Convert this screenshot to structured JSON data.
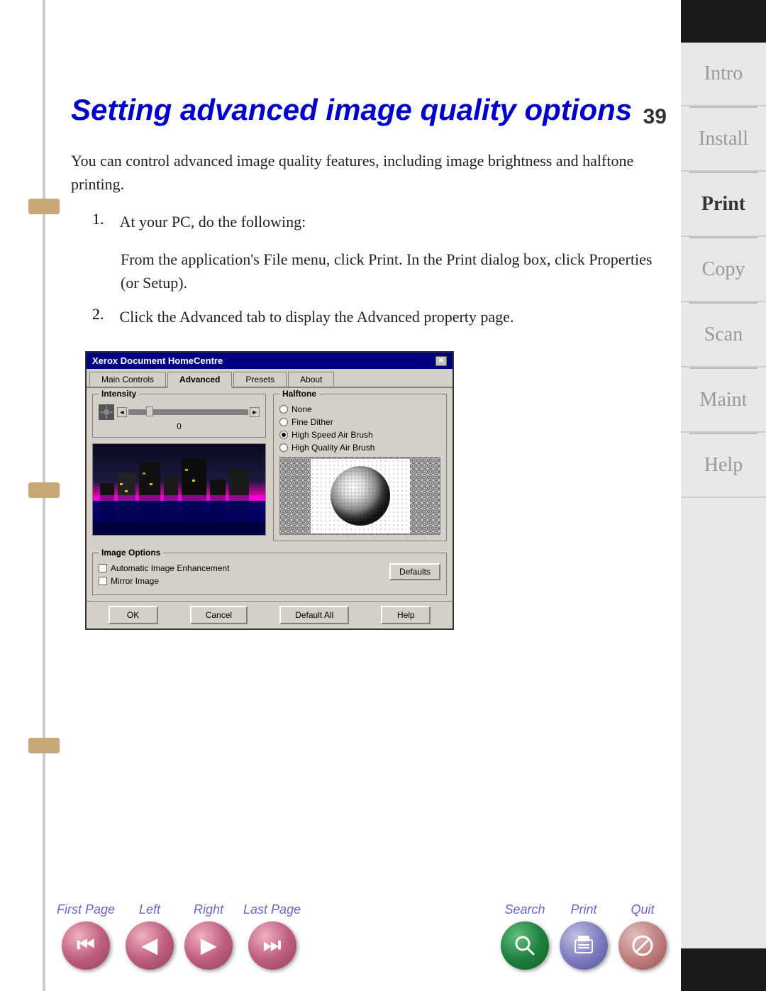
{
  "page": {
    "number": "39",
    "title": "Setting advanced image quality options",
    "body_text_1": "You can control advanced image quality features, including image brightness and halftone printing.",
    "list_item_1_number": "1.",
    "list_item_1_text": "At your PC, do the following:",
    "list_item_1_sub": "From the application's File menu, click Print. In the Print dialog box, click Properties (or Setup).",
    "list_item_2_number": "2.",
    "list_item_2_text": "Click the Advanced tab to display the Advanced property page."
  },
  "dialog": {
    "title": "Xerox Document HomeCentre",
    "close_label": "✕",
    "tabs": {
      "main_controls": "Main Controls",
      "advanced": "Advanced",
      "presets": "Presets",
      "about": "About"
    },
    "intensity_label": "Intensity",
    "intensity_value": "0",
    "halftone_label": "Halftone",
    "radio_none": "None",
    "radio_fine_dither": "Fine Dither",
    "radio_high_speed": "High Speed Air Brush",
    "radio_high_quality": "High Quality Air Brush",
    "image_options_label": "Image Options",
    "auto_enhance": "Automatic Image Enhancement",
    "mirror_image": "Mirror Image",
    "defaults_btn": "Defaults",
    "ok_btn": "OK",
    "cancel_btn": "Cancel",
    "default_all_btn": "Default All",
    "help_btn": "Help"
  },
  "sidebar": {
    "intro": "Intro",
    "install": "Install",
    "print": "Print",
    "copy": "Copy",
    "scan": "Scan",
    "maint": "Maint",
    "help": "Help"
  },
  "nav": {
    "first_page": "First Page",
    "left": "Left",
    "right": "Right",
    "last_page": "Last Page",
    "search": "Search",
    "print": "Print",
    "quit": "Quit",
    "first_icon": "⏮",
    "left_icon": "◀",
    "right_icon": "▶",
    "last_icon": "⏭",
    "search_icon": "🔍",
    "print_icon": "🖹",
    "quit_icon": "⊘"
  }
}
